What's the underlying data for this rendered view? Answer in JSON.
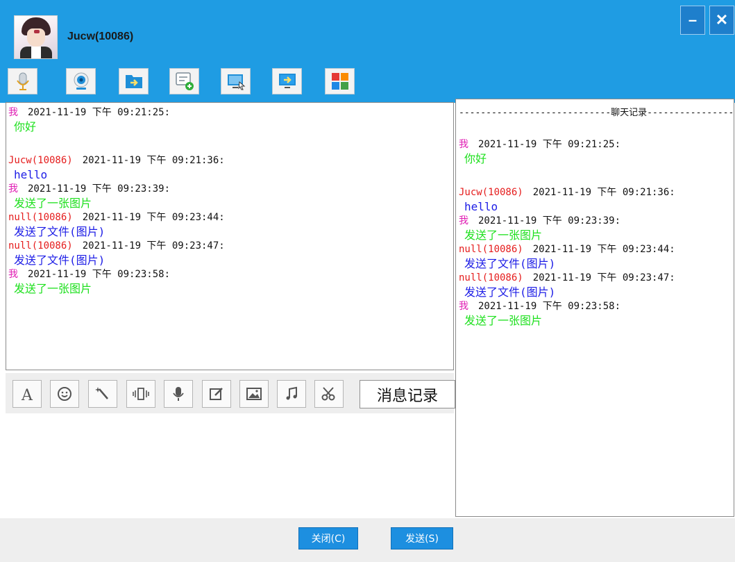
{
  "header": {
    "username": "Jucw(10086)",
    "minimize_label": "–",
    "close_label": "✕"
  },
  "top_toolbar": [
    {
      "icon": "microphone-icon"
    },
    {
      "icon": "webcam-icon"
    },
    {
      "icon": "send-file-icon"
    },
    {
      "icon": "add-chat-icon"
    },
    {
      "icon": "remote-desktop-icon"
    },
    {
      "icon": "screen-share-icon"
    },
    {
      "icon": "apps-grid-icon"
    }
  ],
  "chat": {
    "messages": [
      {
        "sender": "我",
        "time": "2021-11-19 下午 09:21:25:",
        "text": "你好"
      },
      {
        "sender": "Jucw(10086)",
        "time": "2021-11-19 下午 09:21:36:",
        "text": "hello"
      },
      {
        "sender": "我",
        "time": "2021-11-19 下午 09:23:39:",
        "text": "发送了一张图片"
      },
      {
        "sender": "null(10086)",
        "time": "2021-11-19 下午 09:23:44:",
        "text": "发送了文件(图片)"
      },
      {
        "sender": "null(10086)",
        "time": "2021-11-19 下午 09:23:47:",
        "text": "发送了文件(图片)"
      },
      {
        "sender": "我",
        "time": "2021-11-19 下午 09:23:58:",
        "text": "发送了一张图片"
      }
    ]
  },
  "history": {
    "title": "----------------------------聊天记录----------------------------"
  },
  "bottom_toolbar": {
    "icons": [
      "font-icon",
      "emoji-icon",
      "magic-wand-icon",
      "shake-icon",
      "voice-icon",
      "edit-icon",
      "image-icon",
      "music-icon",
      "scissors-icon"
    ],
    "history_button": "消息记录"
  },
  "footer": {
    "close_button": "关闭(C)",
    "send_button": "发送(S)"
  },
  "colors": {
    "header_blue": "#1f9ce3",
    "self_sender": "#e01eb4",
    "other_sender": "#e51c1c",
    "self_text": "#1ee01e",
    "other_text": "#1c1ce6"
  }
}
